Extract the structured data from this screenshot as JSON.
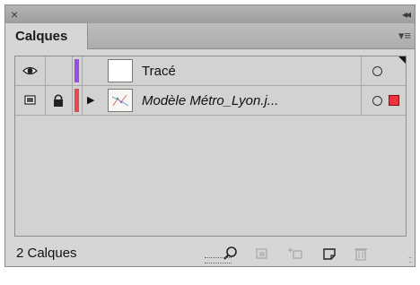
{
  "panel": {
    "tab_label": "Calques",
    "close_glyph": "×",
    "collapse_glyph": "◂◂",
    "menu_glyph": "▾≡"
  },
  "layers": [
    {
      "name": "Tracé",
      "visibility_icon": "eye-icon",
      "locked": false,
      "color": "#9a4ce6",
      "italic": false,
      "thumbnail": "blank",
      "expanded": false,
      "has_children": false,
      "target": "circle",
      "selected": false
    },
    {
      "name": "Modèle Métro_Lyon.j...",
      "visibility_icon": "template-icon",
      "locked": true,
      "color": "#e8474f",
      "italic": true,
      "thumbnail": "map-image",
      "expanded": false,
      "has_children": true,
      "target": "circle",
      "selected": true,
      "selection_color": "#f0353a"
    }
  ],
  "footer": {
    "count_label": "2 Calques",
    "icons": [
      "search-icon",
      "make-clipping-mask-icon",
      "new-sublayer-icon",
      "new-layer-icon",
      "trash-icon"
    ]
  }
}
